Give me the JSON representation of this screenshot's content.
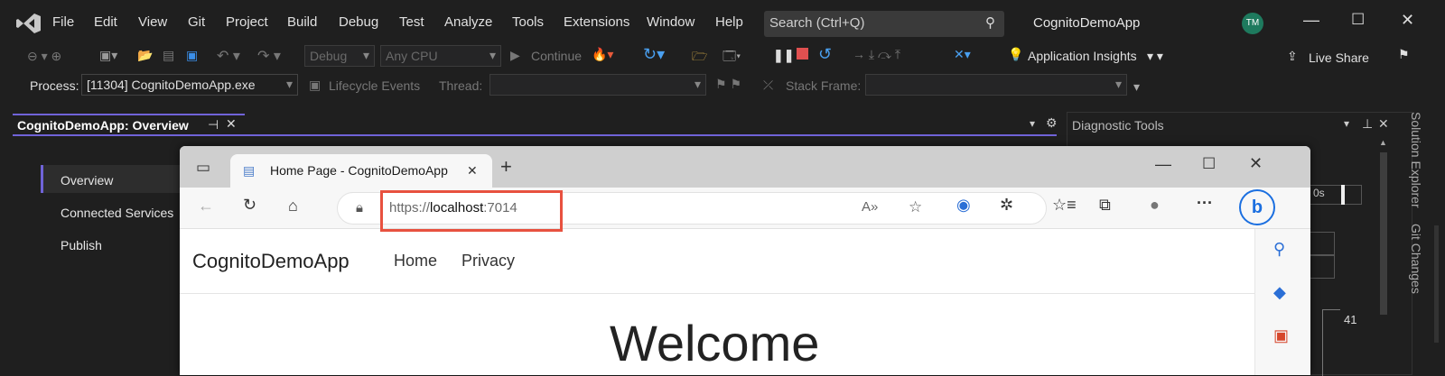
{
  "menu": [
    "File",
    "Edit",
    "View",
    "Git",
    "Project",
    "Build",
    "Debug",
    "Test",
    "Analyze",
    "Tools",
    "Extensions",
    "Window",
    "Help"
  ],
  "search": {
    "placeholder": "Search (Ctrl+Q)"
  },
  "app_title": "CognitoDemoApp",
  "user_initials": "TM",
  "toolbar": {
    "config": "Debug",
    "platform": "Any CPU",
    "continue": "Continue",
    "app_insights": "Application Insights",
    "live_share": "Live Share"
  },
  "debugbar": {
    "process_label": "Process:",
    "process_value": "[11304] CognitoDemoApp.exe",
    "lifecycle": "Lifecycle Events",
    "thread_label": "Thread:",
    "stack_frame_label": "Stack Frame:"
  },
  "doc_tab": "CognitoDemoApp: Overview",
  "overview_nav": [
    "Overview",
    "Connected Services",
    "Publish"
  ],
  "diagnostic_tools": {
    "title": "Diagnostic Tools",
    "value_label": "41",
    "time_label": "0s"
  },
  "right_rail": [
    "Solution Explorer",
    "Git Changes"
  ],
  "browser": {
    "tab_title": "Home Page - CognitoDemoApp",
    "url_scheme": "https://",
    "url_host": "localhost",
    "url_port": ":7014",
    "brand": "CognitoDemoApp",
    "nav_links": [
      "Home",
      "Privacy"
    ],
    "heading": "Welcome"
  }
}
